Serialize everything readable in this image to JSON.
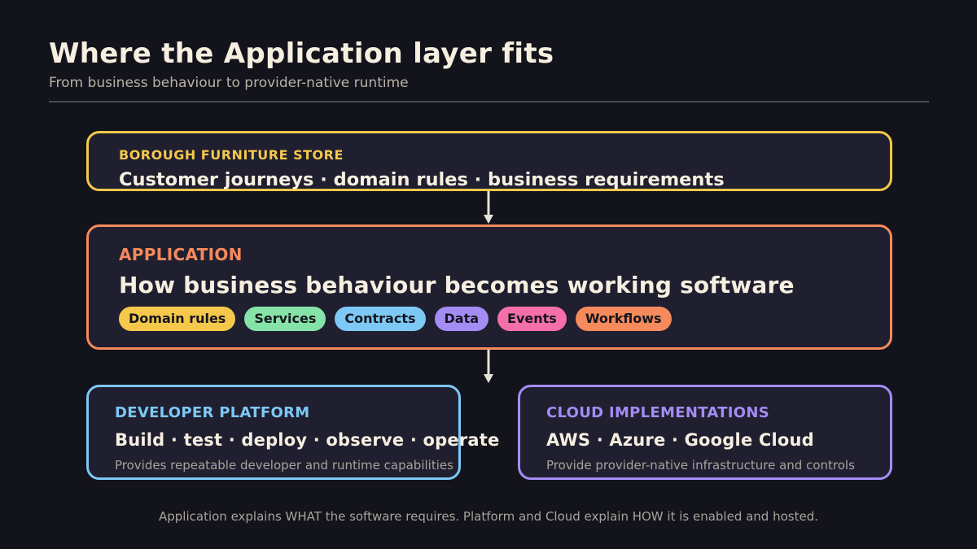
{
  "header": {
    "title": "Where the Application layer fits",
    "subtitle": "From business behaviour to provider-native runtime"
  },
  "business": {
    "label": "BOROUGH FURNITURE STORE",
    "title": "Customer journeys · domain rules · business requirements",
    "color": "#f5c84b"
  },
  "application": {
    "label": "APPLICATION",
    "title": "How business behaviour becomes working software",
    "color": "#f58a5c",
    "pills": [
      {
        "label": "Domain rules",
        "color": "#f5c84b"
      },
      {
        "label": "Services",
        "color": "#86e3a8"
      },
      {
        "label": "Contracts",
        "color": "#7dc8f5"
      },
      {
        "label": "Data",
        "color": "#a48cf5"
      },
      {
        "label": "Events",
        "color": "#f56fa8"
      },
      {
        "label": "Workflows",
        "color": "#f58a5c"
      }
    ]
  },
  "platform": {
    "label": "DEVELOPER PLATFORM",
    "title": "Build · test · deploy · observe · operate",
    "description": "Provides repeatable developer and runtime capabilities",
    "color": "#7dc8f5"
  },
  "cloud": {
    "label": "CLOUD IMPLEMENTATIONS",
    "title": "AWS · Azure · Google Cloud",
    "description": "Provide provider-native infrastructure and controls",
    "color": "#a48cf5"
  },
  "footnote": "Application explains WHAT the software requires. Platform and Cloud explain HOW it is enabled and hosted."
}
